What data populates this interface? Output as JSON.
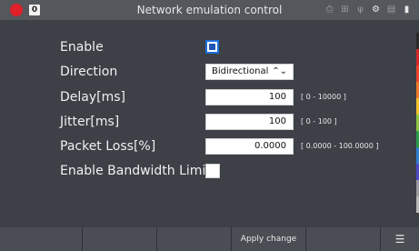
{
  "titlebar": {
    "badge": "0",
    "title": "Network emulation control",
    "icons": [
      "printer-icon",
      "network-icon",
      "usb-icon",
      "wrench-icon",
      "storage-icon",
      "battery-icon"
    ]
  },
  "form": {
    "enable_label": "Enable",
    "direction_label": "Direction",
    "direction_value": "Bidirectional",
    "delay_label": "Delay[ms]",
    "delay_value": "100",
    "delay_range": "[ 0 - 10000 ]",
    "jitter_label": "Jitter[ms]",
    "jitter_value": "100",
    "jitter_range": "[ 0 - 100 ]",
    "loss_label": "Packet Loss[%]",
    "loss_value": "0.0000",
    "loss_range": "[ 0.0000  -  100.0000 ]",
    "bw_label": "Enable Bandwidth Limit",
    "enable_checked": true,
    "bw_checked": false
  },
  "bottombar": {
    "softkeys": [
      "",
      "",
      "",
      "",
      "",
      "Apply change",
      "",
      ""
    ]
  },
  "colors": {
    "accent": "#1f56b4",
    "strip": [
      "#2a2a2a",
      "#d12a2a",
      "#e8452c",
      "#f07a2a",
      "#f2c12e",
      "#8cc63f",
      "#2a9d4a",
      "#2f7fd1",
      "#4b4bc6",
      "#9a9aa0",
      "#b8b8b8"
    ]
  }
}
